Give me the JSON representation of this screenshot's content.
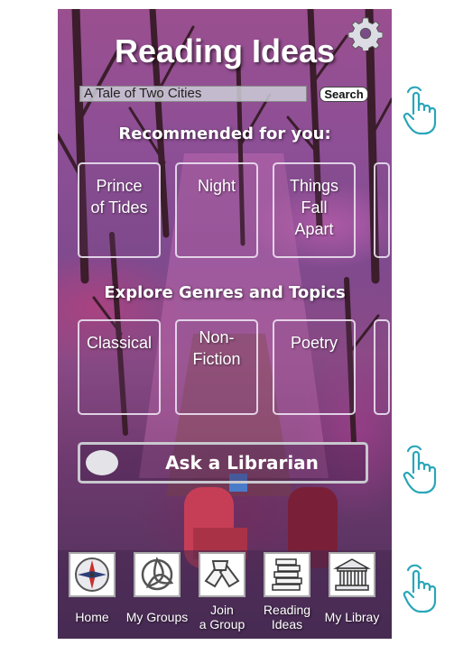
{
  "app": {
    "title": "Reading Ideas"
  },
  "search": {
    "value": "A Tale of Two Cities",
    "button_label": "Search"
  },
  "recommended": {
    "heading": "Recommended for you:",
    "books": [
      {
        "line1": "Prince",
        "line2": "of Tides",
        "line3": ""
      },
      {
        "line1": "Night",
        "line2": "",
        "line3": ""
      },
      {
        "line1": "Things",
        "line2": "Fall",
        "line3": "Apart"
      }
    ]
  },
  "genres": {
    "heading": "Explore Genres and Topics",
    "items": [
      {
        "line1": "Classical",
        "line2": ""
      },
      {
        "line1": "Non-",
        "line2": "Fiction"
      },
      {
        "line1": "Poetry",
        "line2": ""
      }
    ]
  },
  "librarian": {
    "label": "Ask a Librarian"
  },
  "nav": [
    {
      "line1": "Home",
      "line2": "",
      "icon": "compass-icon"
    },
    {
      "line1": "My Groups",
      "line2": "",
      "icon": "triquetra-icon"
    },
    {
      "line1": "Join",
      "line2": "a Group",
      "icon": "join-hands-icon"
    },
    {
      "line1": "Reading",
      "line2": "Ideas",
      "icon": "books-icon"
    },
    {
      "line1": "My Libray",
      "line2": "",
      "icon": "library-building-icon"
    }
  ],
  "colors": {
    "background_top": "#9a4f8f",
    "background_bottom": "#4a2f57",
    "text": "#ffffff",
    "hand_cursor": "#2aa6b8"
  }
}
